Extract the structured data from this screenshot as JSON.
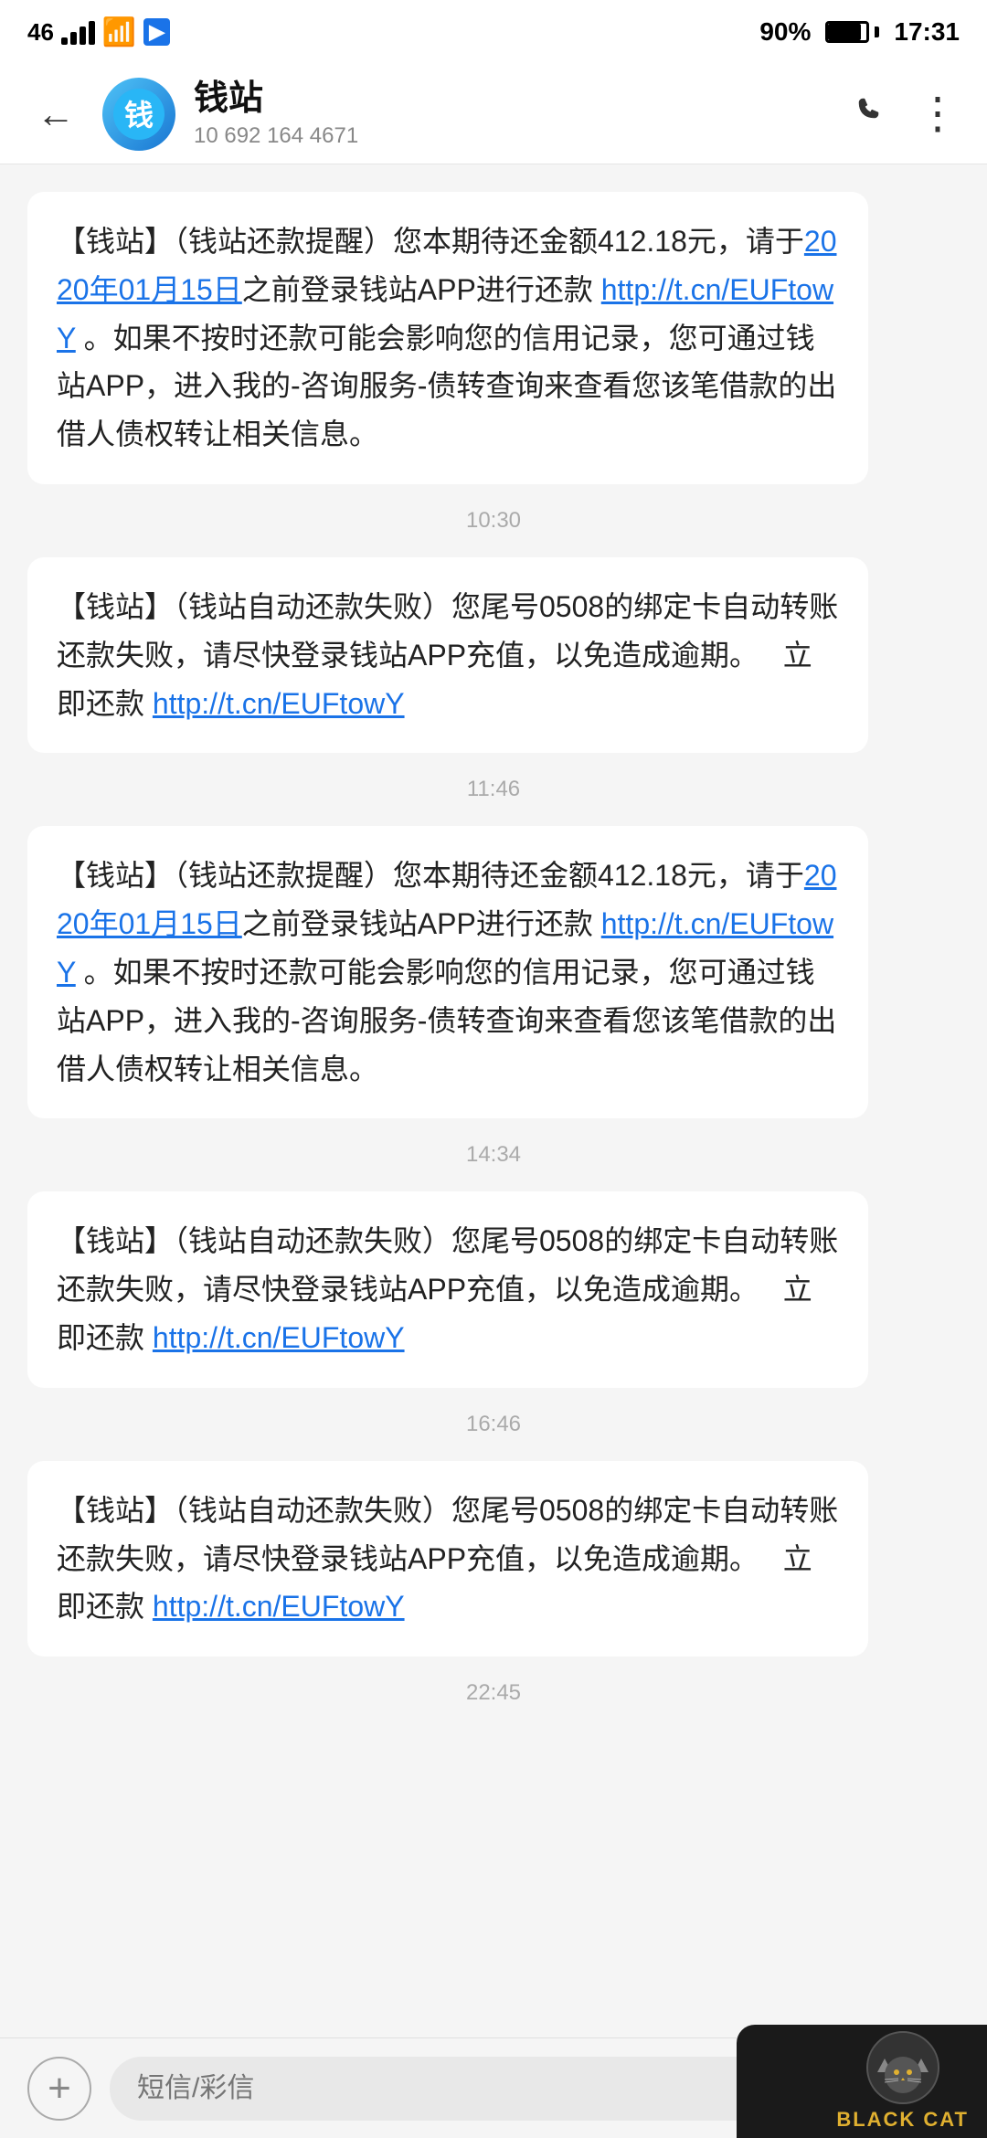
{
  "status_bar": {
    "carrier": "46",
    "battery_percent": "90%",
    "time": "17:31"
  },
  "nav": {
    "back_label": "←",
    "contact_name": "钱站",
    "contact_number": "10 692 164 4671",
    "call_icon": "📞",
    "more_icon": "⋮"
  },
  "messages": [
    {
      "id": "msg1",
      "text_parts": [
        {
          "type": "text",
          "content": "【钱站】（钱站还款提醒）您本期待还金额412.18元，请于"
        },
        {
          "type": "link",
          "content": "2020年01月15日"
        },
        {
          "type": "text",
          "content": "之前登录钱站APP进行还款 "
        },
        {
          "type": "link",
          "content": "http://t.cn/EUFtowY"
        },
        {
          "type": "text",
          "content": " 。如果不按时还款可能会影响您的信用记录，您可通过钱站APP，进入我的-咨询服务-债转查询来查看您该笔借款的出借人债权转让相关信息。"
        }
      ],
      "timestamp": "10:30"
    },
    {
      "id": "msg2",
      "text_parts": [
        {
          "type": "text",
          "content": "【钱站】（钱站自动还款失败）您尾号0508的绑定卡自动转账还款失败，请尽快登录钱站APP充值，以免造成逾期。  立即还款 "
        },
        {
          "type": "link",
          "content": "http://t.cn/EUFtowY"
        }
      ],
      "timestamp": "11:46"
    },
    {
      "id": "msg3",
      "text_parts": [
        {
          "type": "text",
          "content": "【钱站】（钱站还款提醒）您本期待还金额412.18元，请于"
        },
        {
          "type": "link",
          "content": "2020年01月15日"
        },
        {
          "type": "text",
          "content": "之前登录钱站APP进行还款 "
        },
        {
          "type": "link",
          "content": "http://t.cn/EUFtowY"
        },
        {
          "type": "text",
          "content": " 。如果不按时还款可能会影响您的信用记录，您可通过钱站APP，进入我的-咨询服务-债转查询来查看您该笔借款的出借人债权转让相关信息。"
        }
      ],
      "timestamp": "14:34"
    },
    {
      "id": "msg4",
      "text_parts": [
        {
          "type": "text",
          "content": "【钱站】（钱站自动还款失败）您尾号0508的绑定卡自动转账还款失败，请尽快登录钱站APP充值，以免造成逾期。  立即还款 "
        },
        {
          "type": "link",
          "content": "http://t.cn/EUFtowY"
        }
      ],
      "timestamp": "16:46"
    },
    {
      "id": "msg5",
      "text_parts": [
        {
          "type": "text",
          "content": "【钱站】（钱站自动还款失败）您尾号0508的绑定卡自动转账还款失败，请尽快登录钱站APP充值，以免造成逾期。  立即还款 "
        },
        {
          "type": "link",
          "content": "http://t.cn/EUFtowY"
        }
      ],
      "timestamp": "22:45"
    }
  ],
  "bottom_bar": {
    "add_icon": "+",
    "input_placeholder": "短信/彩信"
  },
  "watermark": {
    "brand": "BLACK CAT"
  }
}
